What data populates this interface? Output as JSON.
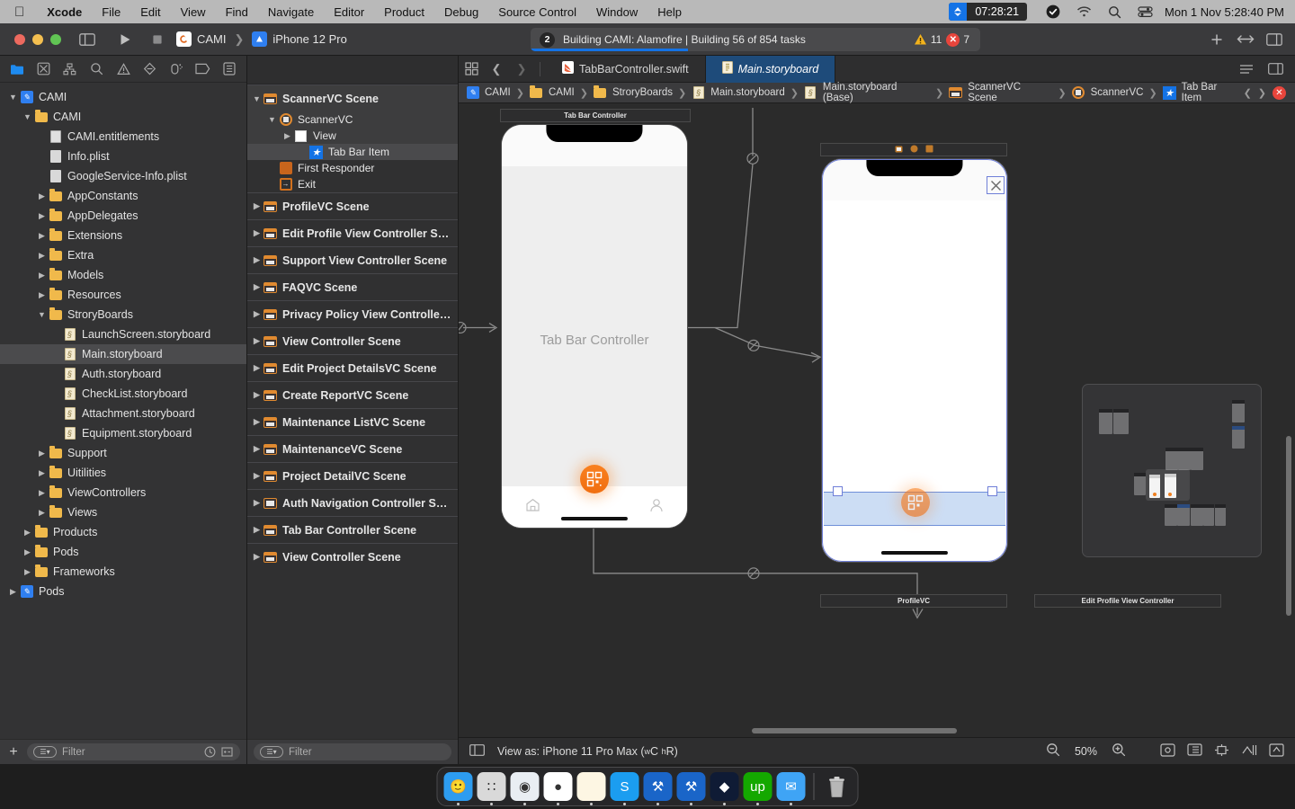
{
  "menubar": {
    "apple_icon": "apple-logo",
    "items": [
      "Xcode",
      "File",
      "Edit",
      "View",
      "Find",
      "Navigate",
      "Editor",
      "Product",
      "Debug",
      "Source Control",
      "Window",
      "Help"
    ],
    "timer_value": "07:28:21",
    "status_icons": [
      "checkmark-icon",
      "wifi-icon",
      "search-icon",
      "control-center-icon"
    ],
    "clock": "Mon 1 Nov  5:28:40 PM"
  },
  "toolbar": {
    "run_label": "run-button",
    "stop_label": "stop-button",
    "scheme_project": "CAMI",
    "scheme_device": "iPhone 12 Pro",
    "activity": {
      "badge": "2",
      "text": "Building CAMI: Alamofire | Building 56 of 854 tasks",
      "warnings": "11",
      "errors": "7",
      "progress_percent": 35
    },
    "right_buttons": [
      "add-editor-button",
      "toggle-editor-button",
      "inspector-toggle-button"
    ]
  },
  "navigator": {
    "icon_tabs": [
      "project-navigator-icon",
      "source-control-navigator-icon",
      "symbol-navigator-icon",
      "find-navigator-icon",
      "issue-navigator-icon",
      "test-navigator-icon",
      "debug-navigator-icon",
      "breakpoint-navigator-icon",
      "report-navigator-icon"
    ],
    "filter_placeholder": "Filter",
    "add_label": "+",
    "tree": [
      {
        "label": "CAMI",
        "icon": "xcode-project-icon",
        "indent": 0,
        "twisty": "down"
      },
      {
        "label": "CAMI",
        "icon": "folder-icon",
        "indent": 1,
        "twisty": "down"
      },
      {
        "label": "CAMI.entitlements",
        "icon": "entitlements-icon",
        "indent": 2,
        "twisty": ""
      },
      {
        "label": "Info.plist",
        "icon": "plist-icon",
        "indent": 2,
        "twisty": ""
      },
      {
        "label": "GoogleService-Info.plist",
        "icon": "plist-icon",
        "indent": 2,
        "twisty": ""
      },
      {
        "label": "AppConstants",
        "icon": "folder-icon",
        "indent": 2,
        "twisty": "right"
      },
      {
        "label": "AppDelegates",
        "icon": "folder-icon",
        "indent": 2,
        "twisty": "right"
      },
      {
        "label": "Extensions",
        "icon": "folder-icon",
        "indent": 2,
        "twisty": "right"
      },
      {
        "label": "Extra",
        "icon": "folder-icon",
        "indent": 2,
        "twisty": "right"
      },
      {
        "label": "Models",
        "icon": "folder-icon",
        "indent": 2,
        "twisty": "right"
      },
      {
        "label": "Resources",
        "icon": "folder-icon",
        "indent": 2,
        "twisty": "right"
      },
      {
        "label": "StroryBoards",
        "icon": "folder-icon",
        "indent": 2,
        "twisty": "down"
      },
      {
        "label": "LaunchScreen.storyboard",
        "icon": "storyboard-icon",
        "indent": 3,
        "twisty": ""
      },
      {
        "label": "Main.storyboard",
        "icon": "storyboard-icon",
        "indent": 3,
        "twisty": "",
        "selected": true
      },
      {
        "label": "Auth.storyboard",
        "icon": "storyboard-icon",
        "indent": 3,
        "twisty": ""
      },
      {
        "label": "CheckList.storyboard",
        "icon": "storyboard-icon",
        "indent": 3,
        "twisty": ""
      },
      {
        "label": "Attachment.storyboard",
        "icon": "storyboard-icon",
        "indent": 3,
        "twisty": ""
      },
      {
        "label": "Equipment.storyboard",
        "icon": "storyboard-icon",
        "indent": 3,
        "twisty": ""
      },
      {
        "label": "Support",
        "icon": "folder-icon",
        "indent": 2,
        "twisty": "right"
      },
      {
        "label": "Uitilities",
        "icon": "folder-icon",
        "indent": 2,
        "twisty": "right"
      },
      {
        "label": "ViewControllers",
        "icon": "folder-icon",
        "indent": 2,
        "twisty": "right"
      },
      {
        "label": "Views",
        "icon": "folder-icon",
        "indent": 2,
        "twisty": "right"
      },
      {
        "label": "Products",
        "icon": "folder-icon",
        "indent": 1,
        "twisty": "right"
      },
      {
        "label": "Pods",
        "icon": "folder-icon",
        "indent": 1,
        "twisty": "right"
      },
      {
        "label": "Frameworks",
        "icon": "folder-icon",
        "indent": 1,
        "twisty": "right"
      },
      {
        "label": "Pods",
        "icon": "xcode-project-icon",
        "indent": 0,
        "twisty": "right"
      }
    ]
  },
  "outline": {
    "filter_placeholder": "Filter",
    "items": [
      {
        "label": "ScannerVC Scene",
        "icon": "view-controller-scene-icon",
        "indent": 0,
        "twisty": "down",
        "kind": "scene",
        "highlight": true
      },
      {
        "label": "ScannerVC",
        "icon": "view-controller-icon",
        "indent": 1,
        "twisty": "down",
        "kind": "item",
        "highlight": true
      },
      {
        "label": "View",
        "icon": "view-icon",
        "indent": 2,
        "twisty": "right",
        "kind": "item",
        "highlight": true
      },
      {
        "label": "Tab Bar Item",
        "icon": "tab-bar-item-icon",
        "indent": 3,
        "twisty": "",
        "kind": "item",
        "selected": true
      },
      {
        "label": "First Responder",
        "icon": "first-responder-icon",
        "indent": 1,
        "twisty": "",
        "kind": "item"
      },
      {
        "label": "Exit",
        "icon": "exit-icon",
        "indent": 1,
        "twisty": "",
        "kind": "item"
      },
      {
        "label": "ProfileVC Scene",
        "icon": "view-controller-scene-icon",
        "indent": 0,
        "twisty": "right",
        "kind": "scene"
      },
      {
        "label": "Edit Profile View Controller S…",
        "icon": "view-controller-scene-icon",
        "indent": 0,
        "twisty": "right",
        "kind": "scene"
      },
      {
        "label": "Support View Controller Scene",
        "icon": "view-controller-scene-icon",
        "indent": 0,
        "twisty": "right",
        "kind": "scene"
      },
      {
        "label": "FAQVC Scene",
        "icon": "view-controller-scene-icon",
        "indent": 0,
        "twisty": "right",
        "kind": "scene"
      },
      {
        "label": "Privacy Policy View Controlle…",
        "icon": "view-controller-scene-icon",
        "indent": 0,
        "twisty": "right",
        "kind": "scene"
      },
      {
        "label": "View Controller Scene",
        "icon": "view-controller-scene-icon",
        "indent": 0,
        "twisty": "right",
        "kind": "scene"
      },
      {
        "label": "Edit Project DetailsVC Scene",
        "icon": "view-controller-scene-icon",
        "indent": 0,
        "twisty": "right",
        "kind": "scene"
      },
      {
        "label": "Create ReportVC Scene",
        "icon": "view-controller-scene-icon",
        "indent": 0,
        "twisty": "right",
        "kind": "scene"
      },
      {
        "label": "Maintenance ListVC Scene",
        "icon": "view-controller-scene-icon",
        "indent": 0,
        "twisty": "right",
        "kind": "scene"
      },
      {
        "label": "MaintenanceVC Scene",
        "icon": "view-controller-scene-icon",
        "indent": 0,
        "twisty": "right",
        "kind": "scene"
      },
      {
        "label": "Project DetailVC Scene",
        "icon": "view-controller-scene-icon",
        "indent": 0,
        "twisty": "right",
        "kind": "scene"
      },
      {
        "label": "Auth Navigation Controller S…",
        "icon": "navigation-controller-scene-icon",
        "indent": 0,
        "twisty": "right",
        "kind": "scene"
      },
      {
        "label": "Tab Bar Controller Scene",
        "icon": "view-controller-scene-icon",
        "indent": 0,
        "twisty": "right",
        "kind": "scene"
      },
      {
        "label": "View Controller Scene",
        "icon": "view-controller-scene-icon",
        "indent": 0,
        "twisty": "right",
        "kind": "scene"
      }
    ]
  },
  "editor": {
    "tabs": [
      {
        "label": "TabBarController.swift",
        "icon": "swift-file-icon",
        "active": false
      },
      {
        "label": "Main.storyboard",
        "icon": "storyboard-icon",
        "active": true
      }
    ],
    "breadcrumb": [
      {
        "label": "CAMI",
        "icon": "xcode-project-icon"
      },
      {
        "label": "CAMI",
        "icon": "folder-icon"
      },
      {
        "label": "StroryBoards",
        "icon": "folder-icon"
      },
      {
        "label": "Main.storyboard",
        "icon": "storyboard-icon"
      },
      {
        "label": "Main.storyboard (Base)",
        "icon": "storyboard-icon"
      },
      {
        "label": "ScannerVC Scene",
        "icon": "view-controller-scene-icon"
      },
      {
        "label": "ScannerVC",
        "icon": "view-controller-icon"
      },
      {
        "label": "Tab Bar Item",
        "icon": "tab-bar-item-icon"
      }
    ]
  },
  "canvas": {
    "scenes": [
      {
        "name": "Tab Bar Controller",
        "title_label": "Tab Bar Controller",
        "body_label": "Tab Bar Controller"
      },
      {
        "name": "ScannerVC",
        "title_label": "",
        "body_label": ""
      }
    ],
    "tab_items": [
      "home-icon",
      "qr-scanner-icon",
      "profile-icon"
    ],
    "partial_scenes": [
      "ProfileVC",
      "Edit Profile View Controller"
    ]
  },
  "canvas_bar": {
    "view_as_prefix": "View as:",
    "view_as_device": "iPhone 11 Pro Max",
    "view_as_traits_w": "w",
    "view_as_traits_wc": "C",
    "view_as_traits_h": "h",
    "view_as_traits_hr": "R",
    "zoom_out_icon": "zoom-out-icon",
    "zoom_level": "50%",
    "zoom_in_icon": "zoom-in-icon",
    "right_tools": [
      "align-icon",
      "embed-in-icon",
      "add-new-constraints-icon",
      "resolve-auto-layout-icon",
      "update-frames-icon"
    ]
  },
  "dock": {
    "icons": [
      {
        "name": "finder-icon",
        "glyph": "🙂",
        "bg": "#2d9cf0"
      },
      {
        "name": "launchpad-icon",
        "glyph": "∷",
        "bg": "#d9d9d9"
      },
      {
        "name": "safari-icon",
        "glyph": "◉",
        "bg": "#e9eef3"
      },
      {
        "name": "chrome-icon",
        "glyph": "●",
        "bg": "#ffffff"
      },
      {
        "name": "notes-icon",
        "glyph": "",
        "bg": "#fdf6e3"
      },
      {
        "name": "skype-icon",
        "glyph": "S",
        "bg": "#1b9df0"
      },
      {
        "name": "xcode-icon",
        "glyph": "⚒",
        "bg": "#1a65c8"
      },
      {
        "name": "xcode-beta-icon",
        "glyph": "⚒",
        "bg": "#1a65c8"
      },
      {
        "name": "zeplin-icon",
        "glyph": "◆",
        "bg": "#0f1b35"
      },
      {
        "name": "upwork-icon",
        "glyph": "up",
        "bg": "#14a800"
      },
      {
        "name": "mail-icon",
        "glyph": "✉",
        "bg": "#3fa4f5"
      }
    ],
    "trash_icon": "trash-icon"
  }
}
